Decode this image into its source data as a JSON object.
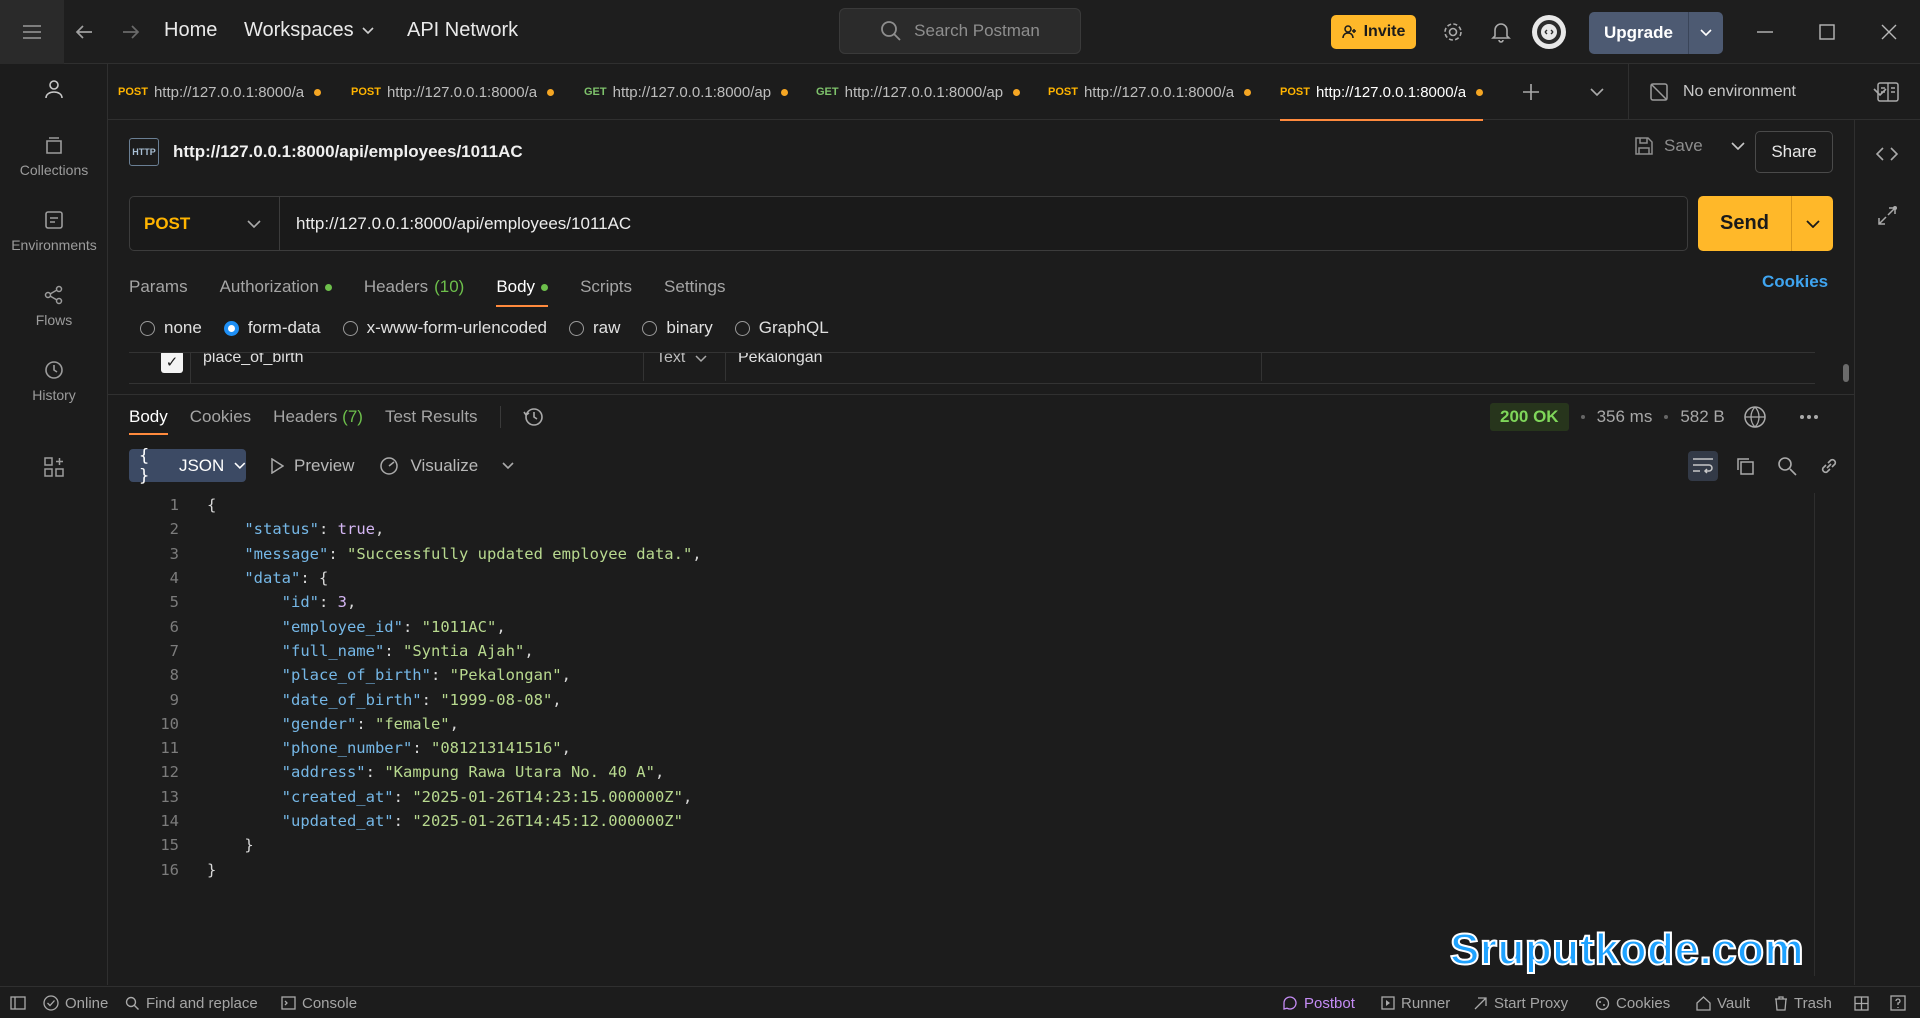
{
  "titlebar": {
    "home": "Home",
    "workspaces": "Workspaces",
    "api_network": "API Network",
    "search_placeholder": "Search Postman",
    "invite": "Invite",
    "upgrade": "Upgrade"
  },
  "sidebar": {
    "items": [
      {
        "label": "Collections"
      },
      {
        "label": "Environments"
      },
      {
        "label": "Flows"
      },
      {
        "label": "History"
      }
    ]
  },
  "tabs": [
    {
      "method": "POST",
      "url": "http://127.0.0.1:8000/a"
    },
    {
      "method": "POST",
      "url": "http://127.0.0.1:8000/a"
    },
    {
      "method": "GET",
      "url": "http://127.0.0.1:8000/ap"
    },
    {
      "method": "GET",
      "url": "http://127.0.0.1:8000/ap"
    },
    {
      "method": "POST",
      "url": "http://127.0.0.1:8000/a"
    },
    {
      "method": "POST",
      "url": "http://127.0.0.1:8000/a"
    }
  ],
  "environment": "No environment",
  "request": {
    "icon_text": "HTTP",
    "title": "http://127.0.0.1:8000/api/employees/1011AC",
    "save": "Save",
    "share": "Share",
    "method": "POST",
    "url": "http://127.0.0.1:8000/api/employees/1011AC",
    "send": "Send",
    "tabs": {
      "params": "Params",
      "authorization": "Authorization",
      "headers": "Headers",
      "headers_count": "(10)",
      "body": "Body",
      "scripts": "Scripts",
      "settings": "Settings"
    },
    "cookies": "Cookies",
    "body_types": [
      "none",
      "form-data",
      "x-www-form-urlencoded",
      "raw",
      "binary",
      "GraphQL"
    ],
    "selected_body_type": "form-data",
    "form_row": {
      "key": "place_of_birth",
      "type": "Text",
      "value": "Pekalongan"
    }
  },
  "response": {
    "tabs": {
      "body": "Body",
      "cookies": "Cookies",
      "headers": "Headers",
      "headers_count": "(7)",
      "test_results": "Test Results"
    },
    "status": "200 OK",
    "time": "356 ms",
    "size": "582 B",
    "format": "JSON",
    "preview": "Preview",
    "visualize": "Visualize"
  },
  "code_lines": [
    {
      "n": "1",
      "parts": [
        [
          "p",
          "{"
        ]
      ]
    },
    {
      "n": "2",
      "parts": [
        [
          "p",
          "    "
        ],
        [
          "k",
          "\"status\""
        ],
        [
          "p",
          ": "
        ],
        [
          "n",
          "true"
        ],
        [
          "p",
          ","
        ]
      ]
    },
    {
      "n": "3",
      "parts": [
        [
          "p",
          "    "
        ],
        [
          "k",
          "\"message\""
        ],
        [
          "p",
          ": "
        ],
        [
          "s",
          "\"Successfully updated employee data.\""
        ],
        [
          "p",
          ","
        ]
      ]
    },
    {
      "n": "4",
      "parts": [
        [
          "p",
          "    "
        ],
        [
          "k",
          "\"data\""
        ],
        [
          "p",
          ": {"
        ]
      ]
    },
    {
      "n": "5",
      "parts": [
        [
          "p",
          "        "
        ],
        [
          "k",
          "\"id\""
        ],
        [
          "p",
          ": "
        ],
        [
          "n",
          "3"
        ],
        [
          "p",
          ","
        ]
      ]
    },
    {
      "n": "6",
      "parts": [
        [
          "p",
          "        "
        ],
        [
          "k",
          "\"employee_id\""
        ],
        [
          "p",
          ": "
        ],
        [
          "s",
          "\"1011AC\""
        ],
        [
          "p",
          ","
        ]
      ]
    },
    {
      "n": "7",
      "parts": [
        [
          "p",
          "        "
        ],
        [
          "k",
          "\"full_name\""
        ],
        [
          "p",
          ": "
        ],
        [
          "s",
          "\"Syntia Ajah\""
        ],
        [
          "p",
          ","
        ]
      ]
    },
    {
      "n": "8",
      "parts": [
        [
          "p",
          "        "
        ],
        [
          "k",
          "\"place_of_birth\""
        ],
        [
          "p",
          ": "
        ],
        [
          "s",
          "\"Pekalongan\""
        ],
        [
          "p",
          ","
        ]
      ]
    },
    {
      "n": "9",
      "parts": [
        [
          "p",
          "        "
        ],
        [
          "k",
          "\"date_of_birth\""
        ],
        [
          "p",
          ": "
        ],
        [
          "s",
          "\"1999-08-08\""
        ],
        [
          "p",
          ","
        ]
      ]
    },
    {
      "n": "10",
      "parts": [
        [
          "p",
          "        "
        ],
        [
          "k",
          "\"gender\""
        ],
        [
          "p",
          ": "
        ],
        [
          "s",
          "\"female\""
        ],
        [
          "p",
          ","
        ]
      ]
    },
    {
      "n": "11",
      "parts": [
        [
          "p",
          "        "
        ],
        [
          "k",
          "\"phone_number\""
        ],
        [
          "p",
          ": "
        ],
        [
          "s",
          "\"081213141516\""
        ],
        [
          "p",
          ","
        ]
      ]
    },
    {
      "n": "12",
      "parts": [
        [
          "p",
          "        "
        ],
        [
          "k",
          "\"address\""
        ],
        [
          "p",
          ": "
        ],
        [
          "s",
          "\"Kampung Rawa Utara No. 40 A\""
        ],
        [
          "p",
          ","
        ]
      ]
    },
    {
      "n": "13",
      "parts": [
        [
          "p",
          "        "
        ],
        [
          "k",
          "\"created_at\""
        ],
        [
          "p",
          ": "
        ],
        [
          "s",
          "\"2025-01-26T14:23:15.000000Z\""
        ],
        [
          "p",
          ","
        ]
      ]
    },
    {
      "n": "14",
      "parts": [
        [
          "p",
          "        "
        ],
        [
          "k",
          "\"updated_at\""
        ],
        [
          "p",
          ": "
        ],
        [
          "s",
          "\"2025-01-26T14:45:12.000000Z\""
        ]
      ]
    },
    {
      "n": "15",
      "parts": [
        [
          "p",
          "    }"
        ]
      ]
    },
    {
      "n": "16",
      "parts": [
        [
          "p",
          "}"
        ]
      ]
    }
  ],
  "watermark": "Sruputkode.com",
  "statusbar": {
    "online": "Online",
    "find_replace": "Find and replace",
    "console": "Console",
    "postbot": "Postbot",
    "runner": "Runner",
    "start_proxy": "Start Proxy",
    "cookies": "Cookies",
    "vault": "Vault",
    "trash": "Trash"
  },
  "colors": {
    "accent": "#ffb829",
    "post": "#ffb400",
    "get": "#7ec26b",
    "ok": "#7fd65a",
    "link": "#3fa4ef"
  }
}
